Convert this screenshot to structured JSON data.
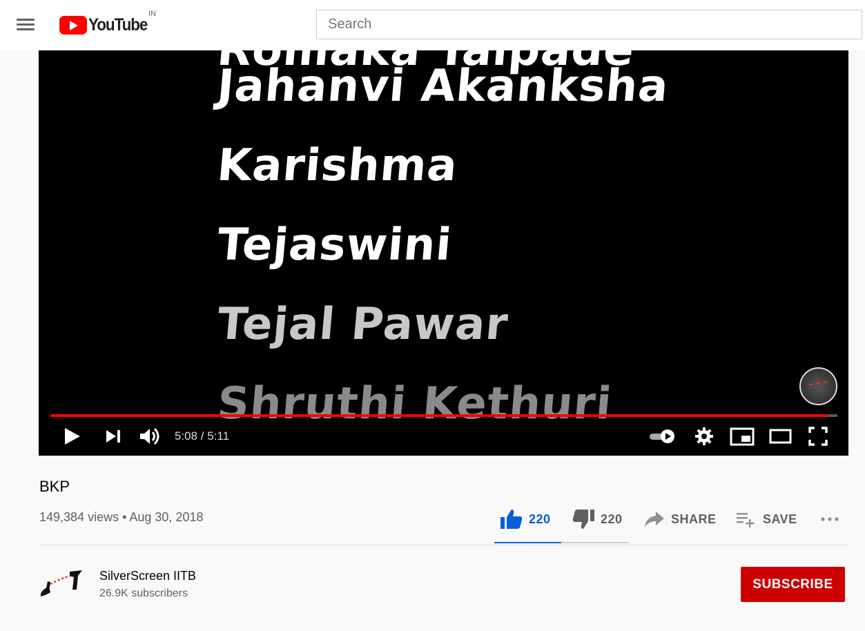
{
  "masthead": {
    "logo_text": "YouTube",
    "country_code": "IN",
    "search_placeholder": "Search"
  },
  "player": {
    "credits": [
      "Romaka Talpade",
      "Jahanvi Akanksha",
      "Karishma",
      "Tejaswini",
      "Tejal Pawar",
      "Shruthi Kethuri"
    ],
    "time_current": "5:08",
    "time_total": "5:11",
    "time_display": "5:08 / 5:11",
    "progress_fraction": 0.987,
    "colors": {
      "progress": "#ff0000"
    }
  },
  "video": {
    "title": "BKP",
    "views_date": "149,384 views • Aug 30, 2018"
  },
  "actions": {
    "like_count": "220",
    "dislike_count": "220",
    "share_label": "SHARE",
    "save_label": "SAVE",
    "like_color": "#065fd4"
  },
  "channel": {
    "name": "SilverScreen IITB",
    "subscribers": "26.9K subscribers",
    "subscribe_label": "SUBSCRIBE",
    "subscribe_color": "#cc0000"
  }
}
